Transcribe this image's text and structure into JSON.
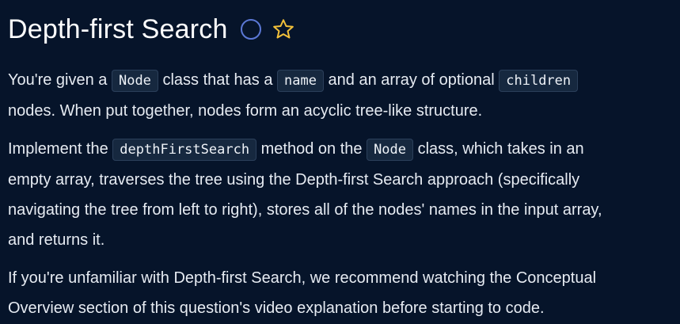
{
  "header": {
    "title": "Depth-first Search",
    "status_icon": "circle-outline-icon",
    "favorite_icon": "star-outline-icon",
    "colors": {
      "status_ring": "#5b78d6",
      "star": "#f3c13a"
    }
  },
  "description": {
    "p1": {
      "l1_a": "You're given a",
      "l1_code1": "Node",
      "l1_b": "class that has a",
      "l1_code2": "name",
      "l1_c": "and an array of optional",
      "l1_code3": "children",
      "l2": "nodes. When put together, nodes form an acyclic tree-like structure."
    },
    "p2": {
      "l1_a": "Implement the",
      "l1_code1": "depthFirstSearch",
      "l1_b": "method on the",
      "l1_code2": "Node",
      "l1_c": "class, which takes in an",
      "l2": "empty array, traverses the tree using the Depth-first Search approach (specifically",
      "l3": "navigating the tree from left to right), stores all of the nodes' names in the input array,",
      "l4": "and returns it."
    },
    "p3": {
      "l1": "If you're unfamiliar with Depth-first Search, we recommend watching the Conceptual",
      "l2": "Overview section of this question's video explanation before starting to code."
    }
  }
}
